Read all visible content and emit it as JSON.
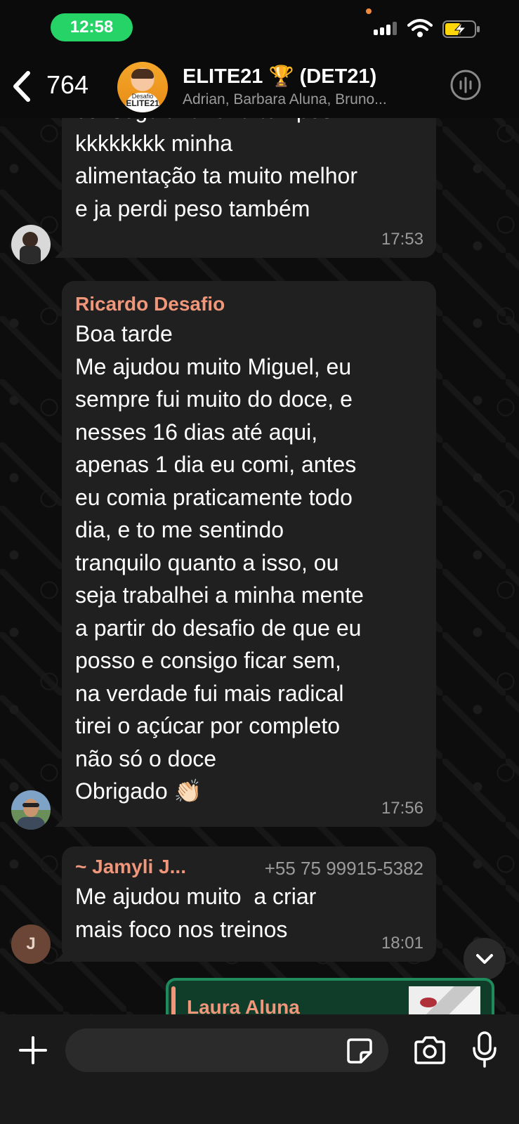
{
  "status_bar": {
    "time": "12:58"
  },
  "header": {
    "unread_count": "764",
    "group_name": "ELITE21 🏆 (DET21)",
    "members": "Adrian, Barbara Aluna, Bruno...",
    "avatar_text_top": "Desafio",
    "avatar_text_bottom": "ELITE21"
  },
  "messages": [
    {
      "sender": "",
      "text": "conseguia fazer a tempos\nkkkkkkkk minha\nalimentação ta muito melhor\ne ja perdi peso também",
      "time": "17:53"
    },
    {
      "sender": "Ricardo Desafio",
      "text": "Boa tarde\nMe ajudou muito Miguel, eu\nsempre fui muito do doce, e\nnesses 16 dias até aqui,\napenas 1 dia eu comi, antes\neu comia praticamente todo\ndia, e to me sentindo\ntranquilo quanto a isso, ou\nseja trabalhei a minha mente\na partir do desafio de que eu\nposso e consigo ficar sem,\nna verdade fui mais radical\ntirei o açúcar por completo\nnão só o doce\nObrigado 👏🏻",
      "time": "17:56"
    },
    {
      "sender": "~ Jamyli J...",
      "phone": "+55 75 99915-5382",
      "text": "Me ajudou muito  a criar\nmais foco nos treinos",
      "time": "18:01",
      "avatar_initial": "J"
    }
  ],
  "quoted_preview": {
    "name": "Laura Aluna"
  },
  "composer": {
    "placeholder": ""
  },
  "colors": {
    "accent_green": "#25d366",
    "sender_color": "#f0967a",
    "bubble_bg": "#202020",
    "background": "#0b0b0b"
  },
  "icons": [
    "back-chevron-icon",
    "wifi-icon",
    "battery-charging-icon",
    "call-icon",
    "chevron-down-icon",
    "plus-icon",
    "sticker-icon",
    "camera-icon",
    "mic-icon"
  ]
}
